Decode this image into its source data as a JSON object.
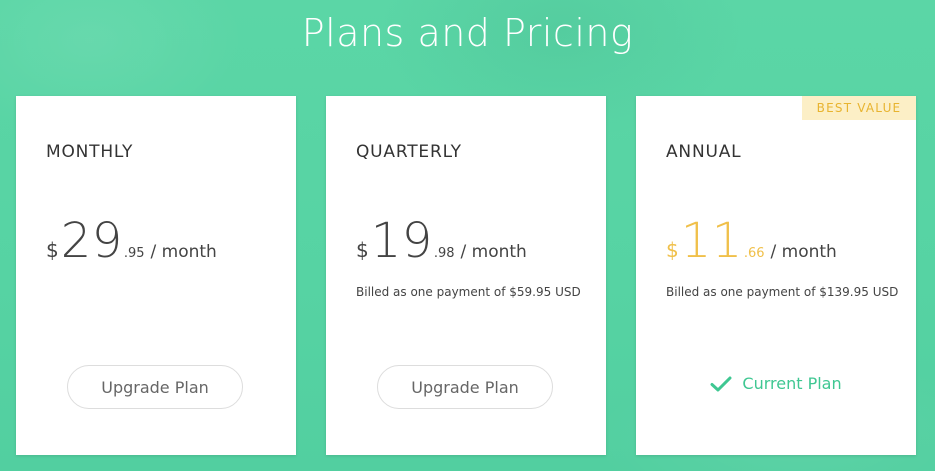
{
  "page": {
    "title": "Plans and Pricing"
  },
  "plans": [
    {
      "name": "MONTHLY",
      "currency": "$",
      "price_whole": "29",
      "price_cents": ".95",
      "period": "/ month",
      "billed": "",
      "action_label": "Upgrade Plan"
    },
    {
      "name": "QUARTERLY",
      "currency": "$",
      "price_whole": "19",
      "price_cents": ".98",
      "period": "/ month",
      "billed": "Billed as one payment of $59.95 USD",
      "action_label": "Upgrade Plan"
    },
    {
      "name": "ANNUAL",
      "currency": "$",
      "price_whole": "11",
      "price_cents": ".66",
      "period": "/ month",
      "billed": "Billed as one payment of $139.95 USD",
      "badge": "BEST VALUE",
      "status_label": "Current Plan",
      "status_icon": "check-icon"
    }
  ],
  "colors": {
    "background": "#58d4a4",
    "accent_price": "#f0c04a",
    "badge_bg": "#fcefc6",
    "badge_text": "#e8b430",
    "current_plan": "#3fc792"
  }
}
